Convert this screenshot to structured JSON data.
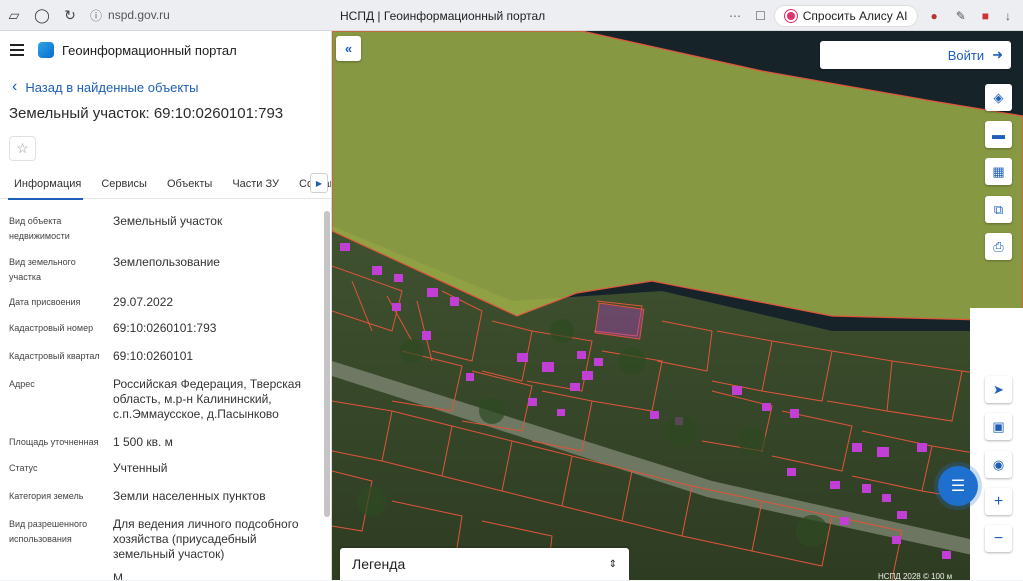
{
  "browser": {
    "url": "nspd.gov.ru",
    "tab_title": "НСПД | Геоинформационный портал",
    "alice_label": "Спросить Алису AI"
  },
  "sidebar": {
    "app_title": "Геоинформационный портал",
    "back_label": "Назад в найденные объекты",
    "object_title": "Земельный участок: 69:10:0260101:793",
    "tabs": [
      "Информация",
      "Сервисы",
      "Объекты",
      "Части ЗУ",
      "Состав"
    ],
    "properties": [
      {
        "label": "Вид объекта недвижимости",
        "value": "Земельный участок"
      },
      {
        "label": "Вид земельного участка",
        "value": "Землепользование"
      },
      {
        "label": "Дата присвоения",
        "value": "29.07.2022"
      },
      {
        "label": "Кадастровый номер",
        "value": "69:10:0260101:793"
      },
      {
        "label": "Кадастровый квартал",
        "value": "69:10:0260101"
      },
      {
        "label": "Адрес",
        "value": "Российская Федерация, Тверская область, м.р-н Калининский, с.п.Эммаусское, д.Пасынково"
      },
      {
        "label": "Площадь уточненная",
        "value": "1 500 кв. м"
      },
      {
        "label": "Статус",
        "value": "Учтенный"
      },
      {
        "label": "Категория земель",
        "value": "Земли населенных пунктов"
      },
      {
        "label": "Вид разрешенного использования",
        "value": "Для ведения личного подсобного хозяйства (приусадебный земельный участок)"
      },
      {
        "label": "",
        "value": "М"
      }
    ]
  },
  "map": {
    "login_label": "Войти",
    "legend_label": "Легенда",
    "scale_text": "НСПД 2028 © 100 м",
    "colors": {
      "water": "#16242a",
      "field": "#a8b84a",
      "parcel_border": "#e0543a",
      "building": "#c23fd6",
      "accent": "#1f5fb8"
    }
  }
}
